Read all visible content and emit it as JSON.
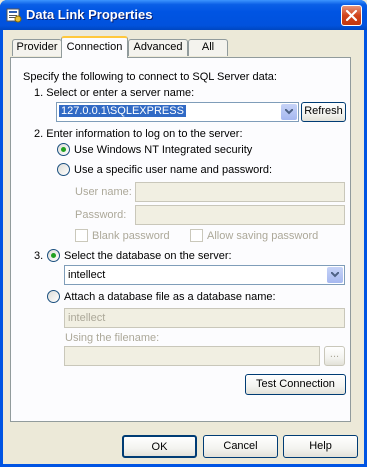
{
  "window": {
    "title": "Data Link Properties",
    "close_label": "X"
  },
  "tabs": [
    {
      "label": "Provider",
      "active": false
    },
    {
      "label": "Connection",
      "active": true
    },
    {
      "label": "Advanced",
      "active": false
    },
    {
      "label": "All",
      "active": false
    }
  ],
  "connection": {
    "intro": "Specify the following to connect to SQL Server data:",
    "step1": "1. Select or enter a server name:",
    "server_value": "127.0.0.1\\SQLEXPRESS",
    "refresh_label": "Refresh",
    "step2": "2. Enter information to log on to the server:",
    "radio_nt": "Use Windows NT Integrated security",
    "radio_specific": "Use a specific user name and password:",
    "username_label": "User name:",
    "password_label": "Password:",
    "blank_password": "Blank password",
    "allow_saving": "Allow saving password",
    "step3_num": "3.",
    "radio_db": "Select the database on the server:",
    "db_value": "intellect",
    "radio_attach": "Attach a database file as a database name:",
    "attach_value": "intellect",
    "using_filename": "Using the filename:",
    "browse_label": "...",
    "test_label": "Test Connection"
  },
  "footer": {
    "ok_label": "OK",
    "cancel_label": "Cancel",
    "help_label": "Help"
  },
  "colors": {
    "titlebar": "#0054e3",
    "selection": "#316ac5",
    "radio_dot": "#21a121"
  }
}
